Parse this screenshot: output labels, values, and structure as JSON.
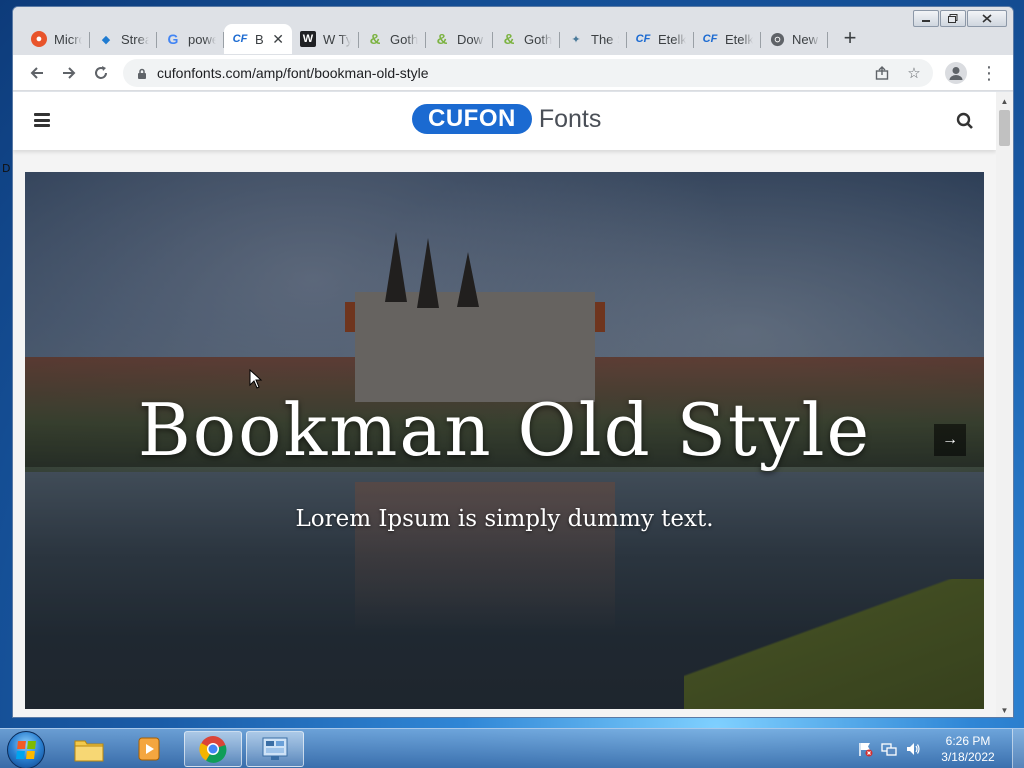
{
  "browser": {
    "tabs": [
      {
        "title": "Micro",
        "icon": "microsoft-icon",
        "color": "#e8542b",
        "glyph": "●"
      },
      {
        "title": "Strea",
        "icon": "stream-icon",
        "color": "#1f7bd1",
        "glyph": "◆"
      },
      {
        "title": "powe",
        "icon": "google-icon",
        "color": "#4285f4",
        "glyph": "G"
      },
      {
        "title": "B",
        "icon": "cufon-icon",
        "color": "#1b6ad1",
        "glyph": "CF",
        "active": true
      },
      {
        "title": "W Ty",
        "icon": "w-icon",
        "color": "#202124",
        "glyph": "W"
      },
      {
        "title": "Goth",
        "icon": "ampersand-icon",
        "color": "#7cb342",
        "glyph": "&"
      },
      {
        "title": "Dow",
        "icon": "ampersand-icon",
        "color": "#7cb342",
        "glyph": "&"
      },
      {
        "title": "Goth",
        "icon": "ampersand-icon",
        "color": "#7cb342",
        "glyph": "&"
      },
      {
        "title": "The S",
        "icon": "bird-icon",
        "color": "#4a7a9a",
        "glyph": "✦"
      },
      {
        "title": "Etelk",
        "icon": "cufon-icon",
        "color": "#1b6ad1",
        "glyph": "CF"
      },
      {
        "title": "Etelk",
        "icon": "cufon-icon",
        "color": "#1b6ad1",
        "glyph": "CF"
      },
      {
        "title": "New",
        "icon": "chrome-icon",
        "color": "#5f6368",
        "glyph": "◉"
      }
    ],
    "new_tab_label": "+",
    "url": "cufonfonts.com/amp/font/bookman-old-style"
  },
  "site": {
    "logo_pill": "CUFON",
    "logo_text": "Fonts",
    "brand_color": "#1b6ad1"
  },
  "hero": {
    "title": "Bookman Old Style",
    "subtitle": "Lorem Ipsum is simply dummy text.",
    "next_arrow": "→"
  },
  "desktop": {
    "glimpse": "D"
  },
  "taskbar": {
    "time": "6:26 PM",
    "date": "3/18/2022"
  }
}
